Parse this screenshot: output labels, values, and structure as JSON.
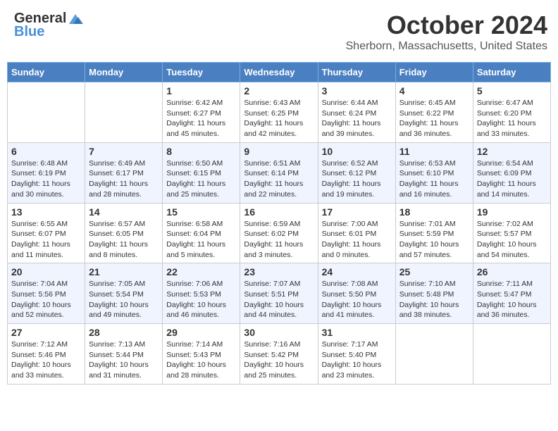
{
  "header": {
    "logo_general": "General",
    "logo_blue": "Blue",
    "month": "October 2024",
    "location": "Sherborn, Massachusetts, United States"
  },
  "days_of_week": [
    "Sunday",
    "Monday",
    "Tuesday",
    "Wednesday",
    "Thursday",
    "Friday",
    "Saturday"
  ],
  "weeks": [
    [
      null,
      null,
      {
        "day": "1",
        "sunrise": "Sunrise: 6:42 AM",
        "sunset": "Sunset: 6:27 PM",
        "daylight": "Daylight: 11 hours and 45 minutes."
      },
      {
        "day": "2",
        "sunrise": "Sunrise: 6:43 AM",
        "sunset": "Sunset: 6:25 PM",
        "daylight": "Daylight: 11 hours and 42 minutes."
      },
      {
        "day": "3",
        "sunrise": "Sunrise: 6:44 AM",
        "sunset": "Sunset: 6:24 PM",
        "daylight": "Daylight: 11 hours and 39 minutes."
      },
      {
        "day": "4",
        "sunrise": "Sunrise: 6:45 AM",
        "sunset": "Sunset: 6:22 PM",
        "daylight": "Daylight: 11 hours and 36 minutes."
      },
      {
        "day": "5",
        "sunrise": "Sunrise: 6:47 AM",
        "sunset": "Sunset: 6:20 PM",
        "daylight": "Daylight: 11 hours and 33 minutes."
      }
    ],
    [
      {
        "day": "6",
        "sunrise": "Sunrise: 6:48 AM",
        "sunset": "Sunset: 6:19 PM",
        "daylight": "Daylight: 11 hours and 30 minutes."
      },
      {
        "day": "7",
        "sunrise": "Sunrise: 6:49 AM",
        "sunset": "Sunset: 6:17 PM",
        "daylight": "Daylight: 11 hours and 28 minutes."
      },
      {
        "day": "8",
        "sunrise": "Sunrise: 6:50 AM",
        "sunset": "Sunset: 6:15 PM",
        "daylight": "Daylight: 11 hours and 25 minutes."
      },
      {
        "day": "9",
        "sunrise": "Sunrise: 6:51 AM",
        "sunset": "Sunset: 6:14 PM",
        "daylight": "Daylight: 11 hours and 22 minutes."
      },
      {
        "day": "10",
        "sunrise": "Sunrise: 6:52 AM",
        "sunset": "Sunset: 6:12 PM",
        "daylight": "Daylight: 11 hours and 19 minutes."
      },
      {
        "day": "11",
        "sunrise": "Sunrise: 6:53 AM",
        "sunset": "Sunset: 6:10 PM",
        "daylight": "Daylight: 11 hours and 16 minutes."
      },
      {
        "day": "12",
        "sunrise": "Sunrise: 6:54 AM",
        "sunset": "Sunset: 6:09 PM",
        "daylight": "Daylight: 11 hours and 14 minutes."
      }
    ],
    [
      {
        "day": "13",
        "sunrise": "Sunrise: 6:55 AM",
        "sunset": "Sunset: 6:07 PM",
        "daylight": "Daylight: 11 hours and 11 minutes."
      },
      {
        "day": "14",
        "sunrise": "Sunrise: 6:57 AM",
        "sunset": "Sunset: 6:05 PM",
        "daylight": "Daylight: 11 hours and 8 minutes."
      },
      {
        "day": "15",
        "sunrise": "Sunrise: 6:58 AM",
        "sunset": "Sunset: 6:04 PM",
        "daylight": "Daylight: 11 hours and 5 minutes."
      },
      {
        "day": "16",
        "sunrise": "Sunrise: 6:59 AM",
        "sunset": "Sunset: 6:02 PM",
        "daylight": "Daylight: 11 hours and 3 minutes."
      },
      {
        "day": "17",
        "sunrise": "Sunrise: 7:00 AM",
        "sunset": "Sunset: 6:01 PM",
        "daylight": "Daylight: 11 hours and 0 minutes."
      },
      {
        "day": "18",
        "sunrise": "Sunrise: 7:01 AM",
        "sunset": "Sunset: 5:59 PM",
        "daylight": "Daylight: 10 hours and 57 minutes."
      },
      {
        "day": "19",
        "sunrise": "Sunrise: 7:02 AM",
        "sunset": "Sunset: 5:57 PM",
        "daylight": "Daylight: 10 hours and 54 minutes."
      }
    ],
    [
      {
        "day": "20",
        "sunrise": "Sunrise: 7:04 AM",
        "sunset": "Sunset: 5:56 PM",
        "daylight": "Daylight: 10 hours and 52 minutes."
      },
      {
        "day": "21",
        "sunrise": "Sunrise: 7:05 AM",
        "sunset": "Sunset: 5:54 PM",
        "daylight": "Daylight: 10 hours and 49 minutes."
      },
      {
        "day": "22",
        "sunrise": "Sunrise: 7:06 AM",
        "sunset": "Sunset: 5:53 PM",
        "daylight": "Daylight: 10 hours and 46 minutes."
      },
      {
        "day": "23",
        "sunrise": "Sunrise: 7:07 AM",
        "sunset": "Sunset: 5:51 PM",
        "daylight": "Daylight: 10 hours and 44 minutes."
      },
      {
        "day": "24",
        "sunrise": "Sunrise: 7:08 AM",
        "sunset": "Sunset: 5:50 PM",
        "daylight": "Daylight: 10 hours and 41 minutes."
      },
      {
        "day": "25",
        "sunrise": "Sunrise: 7:10 AM",
        "sunset": "Sunset: 5:48 PM",
        "daylight": "Daylight: 10 hours and 38 minutes."
      },
      {
        "day": "26",
        "sunrise": "Sunrise: 7:11 AM",
        "sunset": "Sunset: 5:47 PM",
        "daylight": "Daylight: 10 hours and 36 minutes."
      }
    ],
    [
      {
        "day": "27",
        "sunrise": "Sunrise: 7:12 AM",
        "sunset": "Sunset: 5:46 PM",
        "daylight": "Daylight: 10 hours and 33 minutes."
      },
      {
        "day": "28",
        "sunrise": "Sunrise: 7:13 AM",
        "sunset": "Sunset: 5:44 PM",
        "daylight": "Daylight: 10 hours and 31 minutes."
      },
      {
        "day": "29",
        "sunrise": "Sunrise: 7:14 AM",
        "sunset": "Sunset: 5:43 PM",
        "daylight": "Daylight: 10 hours and 28 minutes."
      },
      {
        "day": "30",
        "sunrise": "Sunrise: 7:16 AM",
        "sunset": "Sunset: 5:42 PM",
        "daylight": "Daylight: 10 hours and 25 minutes."
      },
      {
        "day": "31",
        "sunrise": "Sunrise: 7:17 AM",
        "sunset": "Sunset: 5:40 PM",
        "daylight": "Daylight: 10 hours and 23 minutes."
      },
      null,
      null
    ]
  ]
}
